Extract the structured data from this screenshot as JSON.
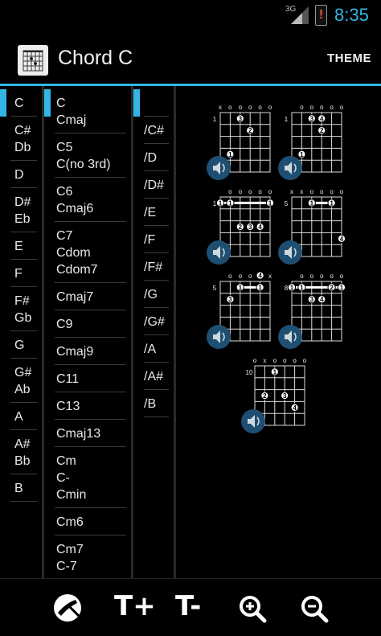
{
  "status_bar": {
    "network": "3G",
    "time": "8:35"
  },
  "action_bar": {
    "title": "Chord C",
    "theme_label": "THEME"
  },
  "root_notes": [
    {
      "label": "C",
      "selected": true
    },
    {
      "label": "C#\nDb"
    },
    {
      "label": "D"
    },
    {
      "label": "D#\nEb"
    },
    {
      "label": "E"
    },
    {
      "label": "F"
    },
    {
      "label": "F#\nGb"
    },
    {
      "label": "G"
    },
    {
      "label": "G#\nAb"
    },
    {
      "label": "A"
    },
    {
      "label": "A#\nBb"
    },
    {
      "label": "B"
    }
  ],
  "chord_types": [
    {
      "label": "C\nCmaj",
      "selected": true
    },
    {
      "label": "C5\nC(no 3rd)"
    },
    {
      "label": "C6\nCmaj6"
    },
    {
      "label": "C7\nCdom\nCdom7"
    },
    {
      "label": "Cmaj7"
    },
    {
      "label": "C9"
    },
    {
      "label": "Cmaj9"
    },
    {
      "label": "C11"
    },
    {
      "label": "C13"
    },
    {
      "label": "Cmaj13"
    },
    {
      "label": "Cm\nC-\nCmin"
    },
    {
      "label": "Cm6"
    },
    {
      "label": "Cm7\nC-7"
    }
  ],
  "bass_notes": [
    {
      "label": "",
      "selected": true
    },
    {
      "label": "/C#"
    },
    {
      "label": "/D"
    },
    {
      "label": "/D#"
    },
    {
      "label": "/E"
    },
    {
      "label": "/F"
    },
    {
      "label": "/F#"
    },
    {
      "label": "/G"
    },
    {
      "label": "/G#"
    },
    {
      "label": "/A"
    },
    {
      "label": "/A#"
    },
    {
      "label": "/B"
    }
  ],
  "chord_diagrams": [
    {
      "fret": "1",
      "open": [
        "x",
        "o",
        "o",
        "o",
        "o",
        "o"
      ],
      "dots": [
        [
          1,
          2,
          "3"
        ],
        [
          2,
          3,
          "2"
        ],
        [
          4,
          1,
          "1"
        ]
      ],
      "barre": null
    },
    {
      "fret": "1",
      "open": [
        "",
        "o",
        "o",
        "o",
        "o",
        "o"
      ],
      "dots": [
        [
          1,
          3,
          "4"
        ],
        [
          1,
          2,
          "3"
        ],
        [
          2,
          3,
          "2"
        ],
        [
          4,
          1,
          "1"
        ]
      ],
      "barre": null
    },
    {
      "fret": "1",
      "open": [
        "",
        "o",
        "o",
        "o",
        "o",
        "o"
      ],
      "dots": [
        [
          3,
          2,
          "2"
        ],
        [
          3,
          3,
          "3"
        ],
        [
          3,
          4,
          "4"
        ]
      ],
      "barre": [
        1,
        0,
        5,
        "1"
      ]
    },
    {
      "fret": "5",
      "open": [
        "x",
        "x",
        "o",
        "o",
        "o",
        "o"
      ],
      "dots": [
        [
          4,
          5,
          "4"
        ]
      ],
      "barre": [
        1,
        2,
        4,
        "1"
      ]
    },
    {
      "fret": "5",
      "open": [
        "",
        "o",
        "o",
        "o",
        "o",
        "x"
      ],
      "dots": [
        [
          2,
          1,
          "3"
        ],
        [
          0,
          4,
          "4"
        ]
      ],
      "barre": [
        1,
        2,
        4,
        "1"
      ]
    },
    {
      "fret": "8",
      "open": [
        "",
        "o",
        "o",
        "o",
        "o",
        "o"
      ],
      "dots": [
        [
          2,
          2,
          "3"
        ],
        [
          2,
          3,
          "4"
        ],
        [
          1,
          4,
          "2"
        ]
      ],
      "barre": [
        1,
        0,
        5,
        "1"
      ]
    },
    {
      "fret": "10",
      "open": [
        "o",
        "x",
        "o",
        "o",
        "o",
        "o"
      ],
      "dots": [
        [
          1,
          2,
          "1"
        ],
        [
          3,
          1,
          "2"
        ],
        [
          3,
          3,
          "3"
        ],
        [
          4,
          4,
          "4"
        ]
      ],
      "barre": null
    }
  ],
  "bottom_bar": {
    "tplus_label": "T+",
    "tminus_label": "T-"
  },
  "colors": {
    "accent": "#33b5e5",
    "background": "#000000",
    "text": "#e8e8e8",
    "sound_button": "#1e4f73"
  },
  "icons": [
    "app-chord-icon",
    "guitar-icon",
    "zoom-in-icon",
    "zoom-out-icon",
    "speaker-icon",
    "signal-icon",
    "battery-alert-icon"
  ]
}
